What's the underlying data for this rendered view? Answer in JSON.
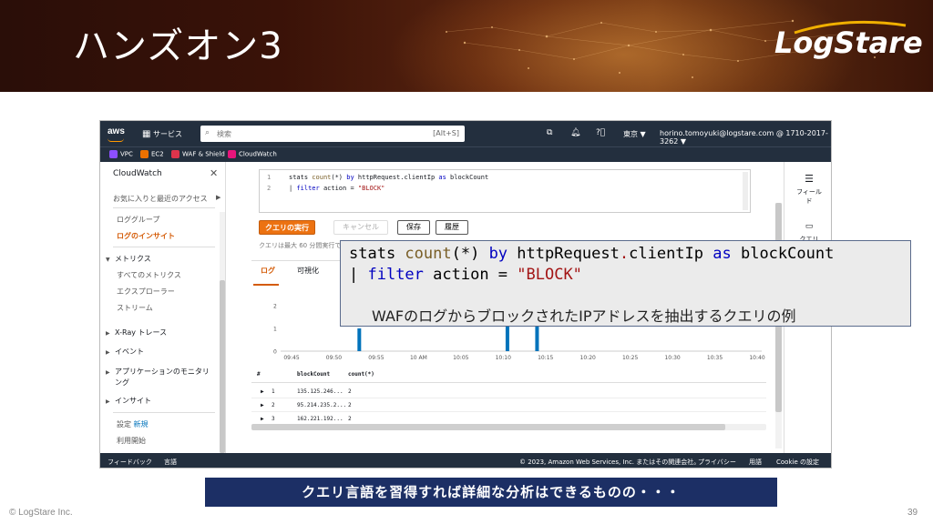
{
  "slide": {
    "title": "ハンズオン3",
    "logo": "LogStare",
    "copyright": "© LogStare Inc.",
    "page_number": "39",
    "bottom_banner": "クエリ言語を習得すれば詳細な分析はできるものの・・・"
  },
  "console": {
    "topnav": {
      "aws": "aws",
      "services": "サービス",
      "search_placeholder": "検索",
      "search_shortcut": "[Alt+S]",
      "region": "東京 ▼",
      "account": "horino.tomoyuki@logstare.com @ 1710-2017-3262 ▼"
    },
    "favorites": [
      {
        "label": "VPC",
        "color": "#8c4fff"
      },
      {
        "label": "EC2",
        "color": "#ed7100"
      },
      {
        "label": "WAF & Shield",
        "color": "#dd344c"
      },
      {
        "label": "CloudWatch",
        "color": "#e7157b"
      }
    ],
    "sidebar": {
      "title": "CloudWatch",
      "fav_recent": "お気に入りと最近のアクセス",
      "items": {
        "log_groups": "ロググループ",
        "log_insights": "ログのインサイト",
        "metrics": "メトリクス",
        "all_metrics": "すべてのメトリクス",
        "explorer": "エクスプローラー",
        "streams": "ストリーム",
        "xray": "X-Ray トレース",
        "events": "イベント",
        "app_monitoring": "アプリケーションのモニタリ",
        "app_monitoring_2": "ング",
        "insights": "インサイト",
        "settings": "設定",
        "new": "新規",
        "getting_started": "利用開始"
      }
    },
    "editor": {
      "line1_no": "1",
      "line2_no": "2",
      "l1_stats": "stats ",
      "l1_count": "count",
      "l1_args": "(*) ",
      "l1_by": "by",
      "l1_field": " httpRequest.clientIp ",
      "l1_as": "as",
      "l1_alias": " blockCount",
      "l2_pipe": "| ",
      "l2_filter": "filter",
      "l2_cond": " action = ",
      "l2_val": "\"BLOCK\""
    },
    "buttons": {
      "run": "クエリの実行",
      "cancel": "キャンセル",
      "save": "保存",
      "history": "履歴"
    },
    "note": "クエリは最大 60 分間実行できます",
    "tabs": {
      "log": "ログ",
      "vis": "可視化"
    },
    "results": {
      "headers": [
        "#",
        "blockCount",
        "count(*)"
      ],
      "rows": [
        {
          "n": "1",
          "ip": "135.125.246...",
          "count": "2"
        },
        {
          "n": "2",
          "ip": "95.214.235.2...",
          "count": "2"
        },
        {
          "n": "3",
          "ip": "162.221.192...",
          "count": "2"
        }
      ]
    },
    "rightpanel": {
      "fields": "フィール\nド",
      "query": "クエリ"
    },
    "footer": {
      "feedback": "フィードバック",
      "language": "言語",
      "copyright": "© 2023, Amazon Web Services, Inc. またはその関連会社。",
      "privacy": "プライバシー",
      "terms": "用語",
      "cookie": "Cookie の設定"
    }
  },
  "overlay": {
    "l1_stats": "stats ",
    "l1_count": "count",
    "l1_args": "(*) ",
    "l1_by": "by",
    "l1_field1": " httpRequest",
    "l1_dot": ".",
    "l1_field2": "clientIp ",
    "l1_as": "as",
    "l1_alias": " blockCount",
    "l2_pipe": "| ",
    "l2_filter": "filter",
    "l2_cond": " action = ",
    "l2_val": "\"BLOCK\"",
    "caption": "WAFのログからブロックされたIPアドレスを抽出するクエリの例"
  },
  "chart_data": {
    "type": "bar",
    "categories": [
      "09:45",
      "09:50",
      "09:55",
      "10 AM",
      "10:05",
      "10:10",
      "10:15",
      "10:20",
      "10:25",
      "10:30",
      "10:35",
      "10:40"
    ],
    "yticks": [
      "2",
      "1",
      "0"
    ],
    "ylim": [
      0,
      2
    ],
    "bars": [
      {
        "x": 9.53,
        "value": 1
      },
      {
        "x": 10.105,
        "value": 2
      },
      {
        "x": 10.14,
        "value": 2
      }
    ],
    "color": "#0073bb"
  }
}
